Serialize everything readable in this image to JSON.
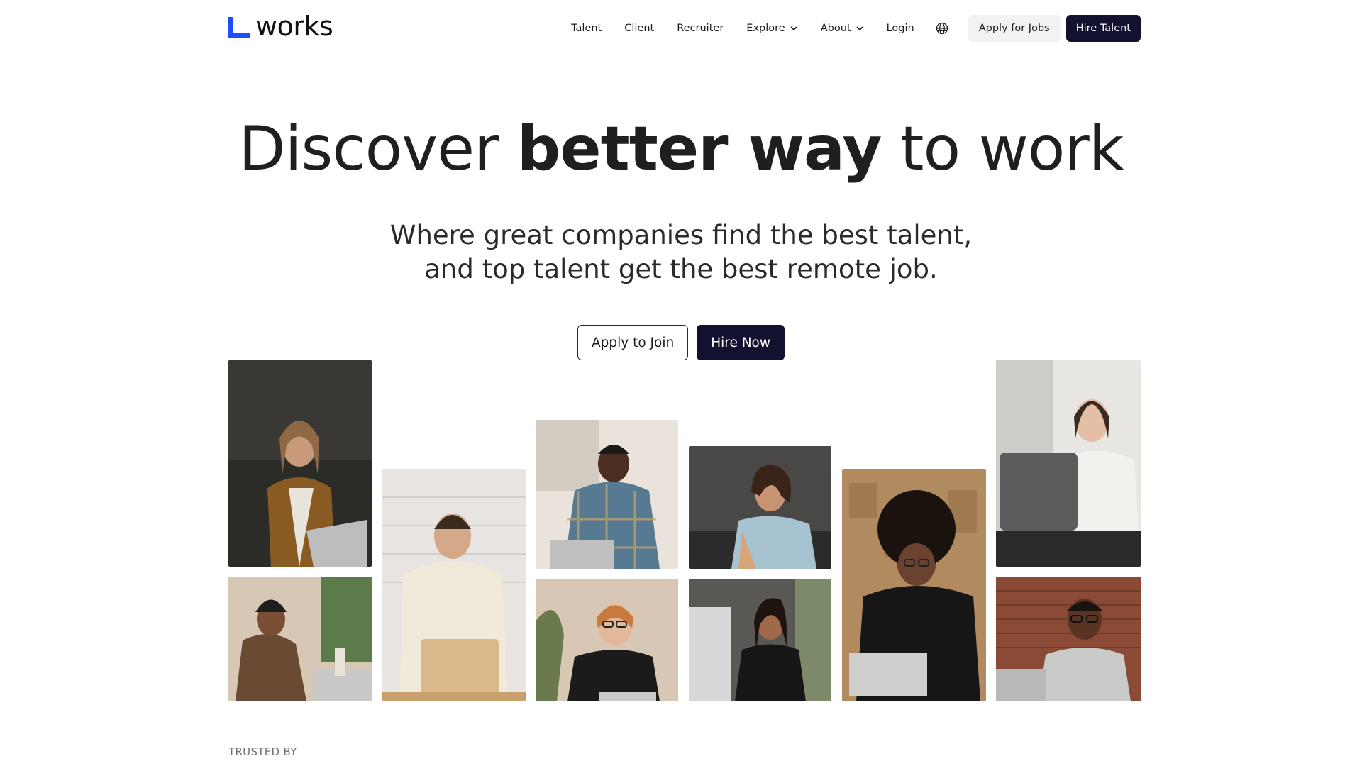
{
  "brand": {
    "name": "works",
    "accent": "#1e4dff"
  },
  "nav": {
    "items": [
      {
        "label": "Talent",
        "dropdown": false
      },
      {
        "label": "Client",
        "dropdown": false
      },
      {
        "label": "Recruiter",
        "dropdown": false
      },
      {
        "label": "Explore",
        "dropdown": true
      },
      {
        "label": "About",
        "dropdown": true
      },
      {
        "label": "Login",
        "dropdown": false
      }
    ],
    "language_icon": "globe-icon",
    "apply_jobs_label": "Apply for Jobs",
    "hire_talent_label": "Hire Talent"
  },
  "hero": {
    "title_part1": "Discover ",
    "title_bold": "better way",
    "title_part2": " to work",
    "subtitle_line1": "Where great companies find the best talent,",
    "subtitle_line2": "and top talent get the best remote job.",
    "apply_button": "Apply to Join",
    "hire_button": "Hire Now"
  },
  "photos": [
    "man-long-hair-brown-jacket-laptop",
    "man-beanie-laptop-plant",
    "man-cream-sweater-laptop",
    "man-plaid-shirt-typing",
    "woman-red-hair-glasses",
    "woman-curly-hair-denim-vest",
    "woman-black-blazer-laptop",
    "woman-afro-glasses-laptop",
    "woman-white-blouse-laptop",
    "man-glasses-smiling-laptop"
  ],
  "trusted_by_label": "TRUSTED BY"
}
